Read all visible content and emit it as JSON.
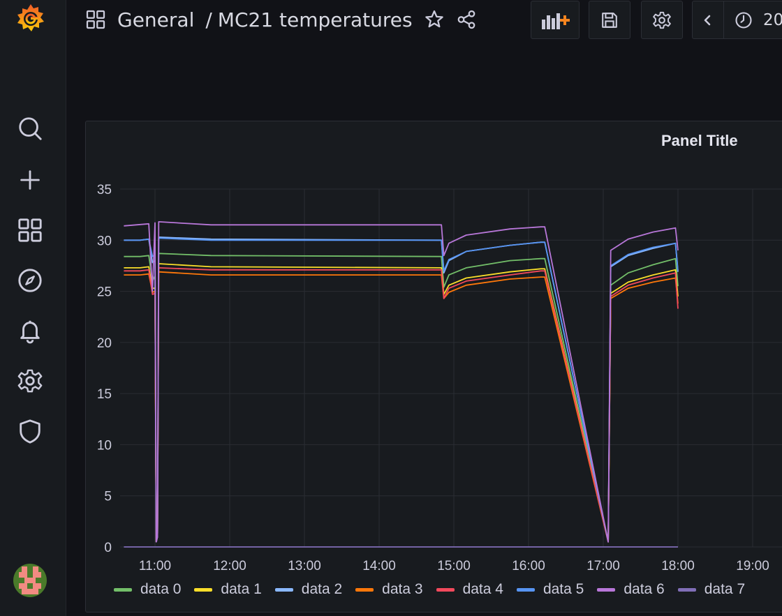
{
  "breadcrumb": {
    "folder": "General",
    "separator": "/",
    "dashboard": "MC21 temperatures"
  },
  "toolbar": {
    "time_range_partial": "20"
  },
  "sidebar": {
    "items": [
      {
        "name": "search",
        "icon": "search-icon"
      },
      {
        "name": "create",
        "icon": "plus-icon"
      },
      {
        "name": "dashboards",
        "icon": "grid-icon"
      },
      {
        "name": "explore",
        "icon": "compass-icon"
      },
      {
        "name": "alerting",
        "icon": "bell-icon"
      },
      {
        "name": "configuration",
        "icon": "gear-icon"
      },
      {
        "name": "server-admin",
        "icon": "shield-icon"
      }
    ]
  },
  "panel": {
    "title": "Panel Title"
  },
  "colors": {
    "background": "#111217",
    "panel": "#181b1f",
    "accent": "#f5841f"
  },
  "chart_data": {
    "type": "line",
    "title": "Panel Title",
    "xlabel": "",
    "ylabel": "",
    "ylim": [
      0,
      35
    ],
    "yticks": [
      "0",
      "5",
      "10",
      "15",
      "20",
      "25",
      "30",
      "35"
    ],
    "xlim": [
      "10:35",
      "19:25"
    ],
    "xticks": [
      "11:00",
      "12:00",
      "13:00",
      "14:00",
      "15:00",
      "16:00",
      "17:00",
      "18:00",
      "19:00"
    ],
    "grid": true,
    "legend_position": "bottom",
    "series": [
      {
        "name": "data 0",
        "color": "#73bf69",
        "points": [
          [
            "10:35",
            28.4
          ],
          [
            "10:48",
            28.4
          ],
          [
            "10:55",
            28.5
          ],
          [
            "10:58",
            26.0
          ],
          [
            "11:00",
            26.5
          ],
          [
            "11:01",
            0.5
          ],
          [
            "11:02",
            1.0
          ],
          [
            "11:03",
            28.7
          ],
          [
            "11:45",
            28.5
          ],
          [
            "14:50",
            28.4
          ],
          [
            "14:52",
            25.4
          ],
          [
            "14:56",
            26.6
          ],
          [
            "15:10",
            27.3
          ],
          [
            "15:45",
            28.0
          ],
          [
            "16:10",
            28.2
          ],
          [
            "16:13",
            28.2
          ],
          [
            "17:04",
            0.5
          ],
          [
            "17:06",
            25.6
          ],
          [
            "17:20",
            26.8
          ],
          [
            "17:40",
            27.6
          ],
          [
            "17:58",
            28.2
          ],
          [
            "18:00",
            25.5
          ]
        ]
      },
      {
        "name": "data 1",
        "color": "#fade2a",
        "points": [
          [
            "10:35",
            27.3
          ],
          [
            "10:48",
            27.3
          ],
          [
            "10:55",
            27.4
          ],
          [
            "10:58",
            25.3
          ],
          [
            "11:00",
            25.3
          ],
          [
            "11:01",
            0.5
          ],
          [
            "11:02",
            1.0
          ],
          [
            "11:03",
            27.7
          ],
          [
            "11:45",
            27.4
          ],
          [
            "14:50",
            27.3
          ],
          [
            "14:52",
            24.7
          ],
          [
            "14:56",
            25.6
          ],
          [
            "15:10",
            26.3
          ],
          [
            "15:45",
            26.9
          ],
          [
            "16:10",
            27.2
          ],
          [
            "16:13",
            27.2
          ],
          [
            "17:04",
            0.5
          ],
          [
            "17:06",
            24.8
          ],
          [
            "17:20",
            25.9
          ],
          [
            "17:40",
            26.6
          ],
          [
            "17:58",
            27.1
          ],
          [
            "18:00",
            24.5
          ]
        ]
      },
      {
        "name": "data 2",
        "color": "#8ab8ff",
        "points": [
          [
            "10:35",
            30.0
          ],
          [
            "10:48",
            30.0
          ],
          [
            "10:55",
            30.1
          ],
          [
            "10:58",
            27.8
          ],
          [
            "11:00",
            28.0
          ],
          [
            "11:01",
            0.5
          ],
          [
            "11:02",
            1.0
          ],
          [
            "11:03",
            30.3
          ],
          [
            "11:45",
            30.1
          ],
          [
            "14:50",
            30.0
          ],
          [
            "14:52",
            26.8
          ],
          [
            "14:56",
            28.0
          ],
          [
            "15:10",
            28.9
          ],
          [
            "15:45",
            29.5
          ],
          [
            "16:10",
            29.8
          ],
          [
            "16:13",
            29.8
          ],
          [
            "17:04",
            0.5
          ],
          [
            "17:06",
            27.4
          ],
          [
            "17:20",
            28.5
          ],
          [
            "17:40",
            29.2
          ],
          [
            "17:58",
            29.7
          ],
          [
            "18:00",
            26.9
          ]
        ]
      },
      {
        "name": "data 3",
        "color": "#ff780a",
        "points": [
          [
            "10:35",
            26.6
          ],
          [
            "10:48",
            26.6
          ],
          [
            "10:55",
            26.7
          ],
          [
            "10:58",
            24.9
          ],
          [
            "11:00",
            25.0
          ],
          [
            "11:01",
            0.5
          ],
          [
            "11:02",
            1.0
          ],
          [
            "11:03",
            26.9
          ],
          [
            "11:45",
            26.6
          ],
          [
            "14:50",
            26.6
          ],
          [
            "14:52",
            24.3
          ],
          [
            "14:56",
            24.9
          ],
          [
            "15:10",
            25.6
          ],
          [
            "15:45",
            26.2
          ],
          [
            "16:10",
            26.4
          ],
          [
            "16:13",
            26.4
          ],
          [
            "17:04",
            0.5
          ],
          [
            "17:06",
            24.3
          ],
          [
            "17:20",
            25.3
          ],
          [
            "17:40",
            25.9
          ],
          [
            "17:58",
            26.3
          ],
          [
            "18:00",
            23.8
          ]
        ]
      },
      {
        "name": "data 4",
        "color": "#f2495c",
        "points": [
          [
            "10:35",
            27.0
          ],
          [
            "10:48",
            27.0
          ],
          [
            "10:55",
            27.1
          ],
          [
            "10:58",
            24.7
          ],
          [
            "11:00",
            24.8
          ],
          [
            "11:01",
            0.5
          ],
          [
            "11:02",
            1.0
          ],
          [
            "11:03",
            27.3
          ],
          [
            "11:45",
            27.1
          ],
          [
            "14:50",
            27.1
          ],
          [
            "14:52",
            24.3
          ],
          [
            "14:56",
            25.3
          ],
          [
            "15:10",
            26.0
          ],
          [
            "15:45",
            26.6
          ],
          [
            "16:10",
            27.0
          ],
          [
            "16:13",
            27.0
          ],
          [
            "17:04",
            0.5
          ],
          [
            "17:06",
            24.5
          ],
          [
            "17:20",
            25.6
          ],
          [
            "17:40",
            26.3
          ],
          [
            "17:58",
            26.8
          ],
          [
            "18:00",
            23.3
          ]
        ]
      },
      {
        "name": "data 5",
        "color": "#5794f2",
        "points": [
          [
            "10:35",
            30.0
          ],
          [
            "10:48",
            30.0
          ],
          [
            "10:55",
            30.1
          ],
          [
            "10:58",
            28.4
          ],
          [
            "11:00",
            28.6
          ],
          [
            "11:01",
            0.5
          ],
          [
            "11:02",
            1.0
          ],
          [
            "11:03",
            30.2
          ],
          [
            "11:45",
            30.0
          ],
          [
            "14:50",
            30.0
          ],
          [
            "14:52",
            27.0
          ],
          [
            "14:56",
            28.1
          ],
          [
            "15:10",
            28.9
          ],
          [
            "15:45",
            29.5
          ],
          [
            "16:10",
            29.8
          ],
          [
            "16:13",
            29.8
          ],
          [
            "17:04",
            0.5
          ],
          [
            "17:06",
            27.5
          ],
          [
            "17:20",
            28.6
          ],
          [
            "17:40",
            29.3
          ],
          [
            "17:58",
            29.7
          ],
          [
            "18:00",
            27.0
          ]
        ]
      },
      {
        "name": "data 6",
        "color": "#b877d9",
        "points": [
          [
            "10:35",
            31.4
          ],
          [
            "10:45",
            31.5
          ],
          [
            "10:55",
            31.6
          ],
          [
            "10:58",
            25.0
          ],
          [
            "11:00",
            31.7
          ],
          [
            "11:01",
            0.5
          ],
          [
            "11:02",
            1.0
          ],
          [
            "11:03",
            31.8
          ],
          [
            "11:45",
            31.5
          ],
          [
            "14:50",
            31.5
          ],
          [
            "14:52",
            28.5
          ],
          [
            "14:56",
            29.7
          ],
          [
            "15:10",
            30.5
          ],
          [
            "15:45",
            31.1
          ],
          [
            "16:10",
            31.3
          ],
          [
            "16:13",
            31.3
          ],
          [
            "17:04",
            0.5
          ],
          [
            "17:06",
            29.0
          ],
          [
            "17:20",
            30.1
          ],
          [
            "17:40",
            30.8
          ],
          [
            "17:58",
            31.2
          ],
          [
            "18:00",
            29.0
          ]
        ]
      },
      {
        "name": "data 7",
        "color": "#806eb7",
        "points": [
          [
            "10:35",
            0
          ],
          [
            "18:00",
            0
          ]
        ]
      }
    ]
  }
}
